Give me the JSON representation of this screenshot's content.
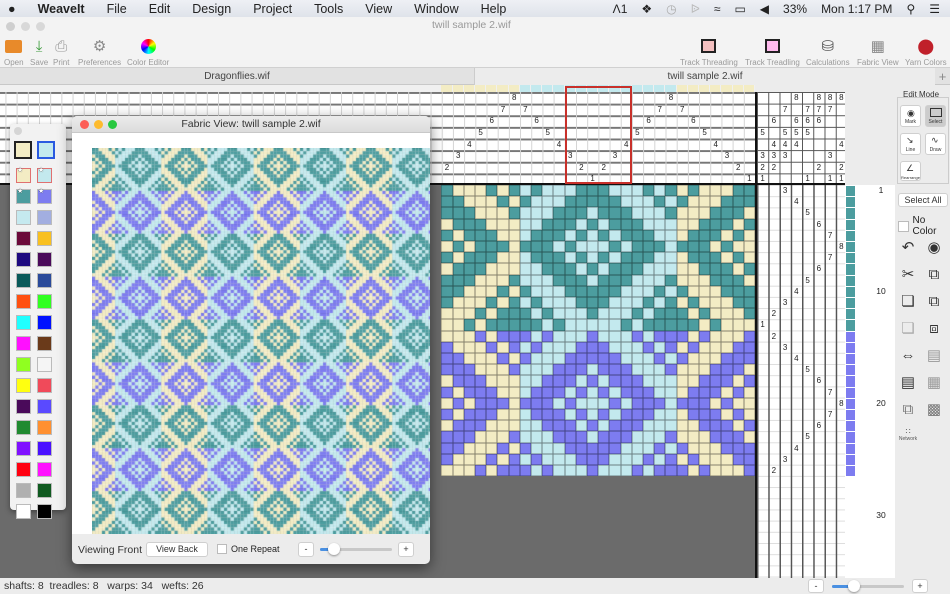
{
  "menubar": {
    "apple": "",
    "app": "WeaveIt",
    "items": [
      "File",
      "Edit",
      "Design",
      "Project",
      "Tools",
      "View",
      "Window",
      "Help"
    ],
    "status": {
      "adobe": "1",
      "battery": "33%",
      "clock": "Mon 1:17 PM"
    }
  },
  "window": {
    "title": "twill sample 2.wif"
  },
  "toolbar": {
    "left": [
      {
        "label": "Open",
        "icon": "folder-icon"
      },
      {
        "label": "Save",
        "icon": "save-icon"
      },
      {
        "label": "Print",
        "icon": "printer-icon"
      },
      {
        "label": "Preferences",
        "icon": "gear-icon"
      },
      {
        "label": "Color Editor",
        "icon": "color-wheel-icon"
      }
    ],
    "right": [
      {
        "label": "Track Threading",
        "icon": "track-threading-icon"
      },
      {
        "label": "Track Treadling",
        "icon": "track-treadling-icon"
      },
      {
        "label": "Calculations",
        "icon": "calculations-icon"
      },
      {
        "label": "Fabric View",
        "icon": "fabric-icon"
      },
      {
        "label": "Yarn Colors",
        "icon": "yarn-icon"
      }
    ]
  },
  "tabs": [
    {
      "label": "Dragonflies.wif",
      "active": false
    },
    {
      "label": "twill sample 2.wif",
      "active": true
    }
  ],
  "tab_add": "+",
  "draft": {
    "colors": {
      "cream": "#f3ecc4",
      "lightblue": "#c3e9ee",
      "teal": "#4c9d9f",
      "purple": "#7d7cf0"
    },
    "threading": [
      1,
      2,
      3,
      4,
      5,
      6,
      7,
      8,
      7,
      6,
      5,
      4,
      3,
      2,
      1,
      2,
      3,
      4,
      5,
      6,
      7,
      8,
      7,
      6,
      5,
      4,
      3,
      2
    ],
    "warp_colors": [
      "cream",
      "cream",
      "cream",
      "cream",
      "cream",
      "cream",
      "cream",
      "lightblue",
      "lightblue",
      "lightblue",
      "lightblue",
      "lightblue",
      "lightblue",
      "lightblue",
      "lightblue",
      "lightblue",
      "lightblue",
      "lightblue",
      "lightblue",
      "lightblue",
      "lightblue",
      "cream",
      "cream",
      "cream",
      "cream",
      "cream",
      "cream",
      "cream"
    ],
    "tieup": {
      "1": [
        1,
        2,
        3,
        5
      ],
      "2": [
        2,
        3,
        4,
        6
      ],
      "3": [
        3,
        4,
        5,
        7
      ],
      "4": [
        4,
        5,
        6,
        8
      ],
      "5": [
        1,
        5,
        6,
        7
      ],
      "6": [
        2,
        6,
        7,
        8
      ],
      "7": [
        1,
        3,
        7,
        8
      ],
      "8": [
        1,
        2,
        4,
        8
      ]
    },
    "treadling": [
      3,
      4,
      5,
      6,
      7,
      8,
      7,
      6,
      5,
      4,
      3,
      2,
      1,
      2,
      3,
      4,
      5,
      6,
      7,
      8,
      7,
      6,
      5,
      4,
      3,
      2
    ],
    "weft_colors": [
      "teal",
      "teal",
      "teal",
      "teal",
      "teal",
      "teal",
      "teal",
      "teal",
      "teal",
      "teal",
      "teal",
      "teal",
      "teal",
      "purple",
      "purple",
      "purple",
      "purple",
      "purple",
      "purple",
      "purple",
      "purple",
      "purple",
      "purple",
      "purple",
      "purple",
      "purple"
    ],
    "row_labels": [
      "1",
      "10",
      "20",
      "30"
    ]
  },
  "palette": {
    "selected": [
      "#f3ecc4",
      "#c3e9ee"
    ],
    "starred": [
      "#f3ecc4",
      "#c3e9ee",
      "#4c9d9f",
      "#7d7cf0"
    ],
    "swatches": [
      "#c5e9ef",
      "#a2aee0",
      "#6b0a3a",
      "#f8c020",
      "#1e0a80",
      "#4a0a5a",
      "#0a5a5a",
      "#2a4a9a",
      "#ff5010",
      "#30ff20",
      "#20ffff",
      "#0010ff",
      "#ff10ff",
      "#6a3a1a",
      "#90ff20",
      "#f5f5f5",
      "#ffff10",
      "#f04a5a",
      "#4a0a5a",
      "#5a4aff",
      "#208a30",
      "#ff9030",
      "#8010ff",
      "#4a10ff",
      "#ff0010",
      "#ff10ff",
      "#b0b0b0",
      "#105a20",
      "#ffffff",
      "#000000"
    ]
  },
  "fabric_view": {
    "title": "Fabric View: twill sample 2.wif",
    "viewing": "Viewing Front",
    "view_back": "View Back",
    "one_repeat": "One Repeat",
    "minus": "-",
    "plus": "+",
    "zoom_fraction": 0.2
  },
  "right_panel": {
    "edit_mode": "Edit Mode",
    "modes": [
      "Mark",
      "Select",
      "Line",
      "Draw",
      "Rearrange"
    ],
    "select_all": "Select All",
    "no_color": "No Color",
    "network": "Network"
  },
  "statusbar": {
    "text": "shafts: 8  treadles: 8   warps: 34   wefts: 26",
    "minus": "-",
    "plus": "+",
    "zoom_fraction": 0.3
  }
}
